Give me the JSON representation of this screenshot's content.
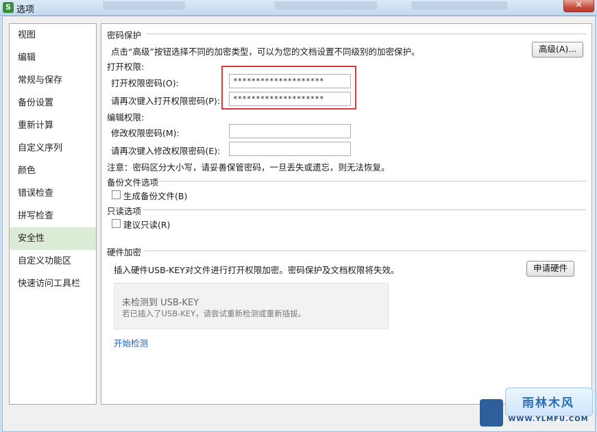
{
  "window": {
    "icon_letter": "S",
    "title": "选项",
    "close_glyph": "✕"
  },
  "sidebar": {
    "items": [
      {
        "label": "视图"
      },
      {
        "label": "编辑"
      },
      {
        "label": "常规与保存"
      },
      {
        "label": "备份设置"
      },
      {
        "label": "重新计算"
      },
      {
        "label": "自定义序列"
      },
      {
        "label": "颜色"
      },
      {
        "label": "错误检查"
      },
      {
        "label": "拼写检查"
      },
      {
        "label": "安全性",
        "active": true
      },
      {
        "label": "自定义功能区"
      },
      {
        "label": "快速访问工具栏"
      }
    ]
  },
  "password_protection": {
    "heading": "密码保护",
    "description": "点击“高级”按钮选择不同的加密类型，可以为您的文档设置不同级别的加密保护。",
    "advanced_button": "高级(A)...",
    "open_permission": {
      "heading": "打开权限:",
      "password_label": "打开权限密码(O):",
      "password_value": "********************",
      "confirm_label": "请再次键入打开权限密码(P):",
      "confirm_value": "********************"
    },
    "edit_permission": {
      "heading": "编辑权限:",
      "password_label": "修改权限密码(M):",
      "password_value": "",
      "confirm_label": "请再次键入修改权限密码(E):",
      "confirm_value": ""
    },
    "note": "注意：密码区分大小写，请妥善保管密码，一旦丢失或遗忘，则无法恢复。"
  },
  "backup": {
    "heading": "备份文件选项",
    "checkbox_label": "生成备份文件(B)",
    "checked": false
  },
  "readonly": {
    "heading": "只读选项",
    "checkbox_label": "建议只读(R)",
    "checked": false
  },
  "hardware": {
    "heading": "硬件加密",
    "description": "插入硬件USB-KEY对文件进行打开权限加密。密码保护及文档权限将失效。",
    "apply_button": "申请硬件",
    "status_title": "未检测到 USB-KEY",
    "status_hint": "若已插入了USB-KEY，请尝试重新检测或重新插拔。",
    "detect_link": "开始检测"
  },
  "watermark": {
    "brand": "雨林木风",
    "url": "WWW.YLMFU.COM"
  },
  "colors": {
    "accent_red": "#d9393e",
    "active_item_bg": "#dcebd6",
    "link": "#1f5db4"
  }
}
